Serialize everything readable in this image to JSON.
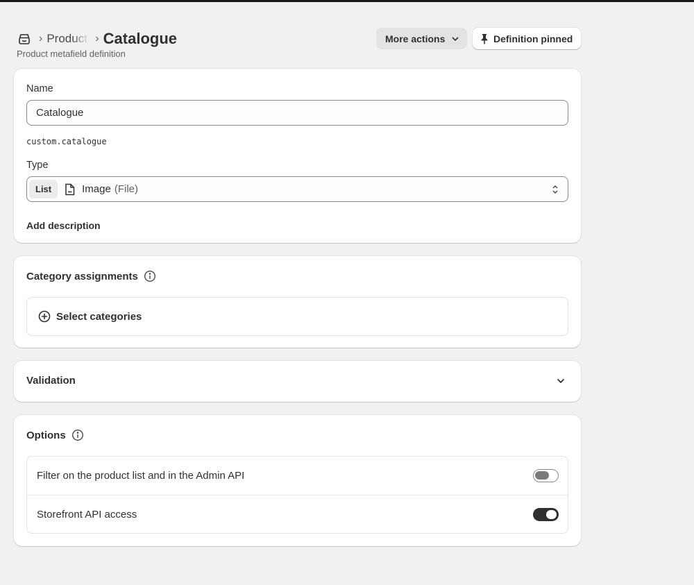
{
  "header": {
    "breadcrumb_parent": "Product",
    "title": "Catalogue",
    "subtitle": "Product metafield definition",
    "more_actions_label": "More actions",
    "pinned_label": "Definition pinned"
  },
  "definition": {
    "name_label": "Name",
    "name_value": "Catalogue",
    "namespace_key": "custom.catalogue",
    "type_label": "Type",
    "type_list_badge": "List",
    "type_name": "Image",
    "type_subtype": "(File)",
    "add_description_label": "Add description"
  },
  "category_assignments": {
    "title": "Category assignments",
    "select_label": "Select categories"
  },
  "validation": {
    "title": "Validation"
  },
  "options": {
    "title": "Options",
    "rows": [
      {
        "label": "Filter on the product list and in the Admin API",
        "enabled": false
      },
      {
        "label": "Storefront API access",
        "enabled": true
      }
    ]
  },
  "icons": {
    "store": "store-icon",
    "breadcrumb_separator": "chevron-right-icon",
    "dropdown": "chevron-down-icon",
    "pin": "pin-icon",
    "file": "file-icon",
    "select_arrows": "select-arrows-icon",
    "info": "info-icon",
    "add": "plus-circle-icon"
  },
  "colors": {
    "background": "#f1f1f1",
    "card": "#ffffff",
    "text": "#303030",
    "muted": "#616161",
    "toggle_on": "#303030"
  }
}
